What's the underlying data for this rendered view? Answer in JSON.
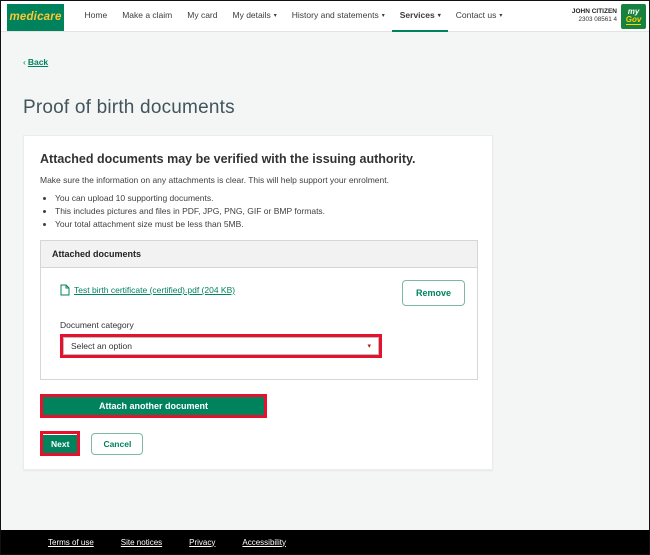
{
  "header": {
    "logo_text": "medicare",
    "caret": "▾",
    "nav_items": [
      {
        "label": "Home"
      },
      {
        "label": "Make a claim"
      },
      {
        "label": "My card"
      },
      {
        "label": "My details"
      },
      {
        "label": "History and statements"
      },
      {
        "label": "Services"
      },
      {
        "label": "Contact us"
      }
    ],
    "user_name": "JOHN CITIZEN",
    "user_number": "2303 08561 4",
    "mygov": {
      "my": "my",
      "gov": "Gov"
    }
  },
  "back": {
    "chevron": "‹",
    "label": "Back"
  },
  "page_title": "Proof of birth documents",
  "card": {
    "heading": "Attached documents may be verified with the issuing authority.",
    "intro": "Make sure the information on any attachments is clear. This will help support your enrolment.",
    "bullets": [
      "You can upload 10 supporting documents.",
      "This includes pictures and files in PDF, JPG, PNG, GIF or BMP formats.",
      "Your total attachment size must be less than 5MB."
    ],
    "attached_panel": {
      "title": "Attached documents",
      "file_name": "Test birth certificate (certified).pdf (204 KB)",
      "remove_label": "Remove",
      "category_label": "Document category",
      "category_value": "Select an option",
      "select_caret": "▾"
    },
    "attach_button": "Attach another document",
    "next_button": "Next",
    "cancel_button": "Cancel"
  },
  "footer": {
    "links": [
      "Terms of use",
      "Site notices",
      "Privacy",
      "Accessibility"
    ]
  },
  "colors": {
    "brand_green": "#00835d",
    "brand_yellow": "#fdc82f",
    "mygov_green": "#17823f",
    "mygov_yellow": "#ffd200",
    "annotation_red": "#e8112d",
    "page_background": "#f3f6f5",
    "title_color": "#42545c",
    "footer_black": "#000000"
  }
}
